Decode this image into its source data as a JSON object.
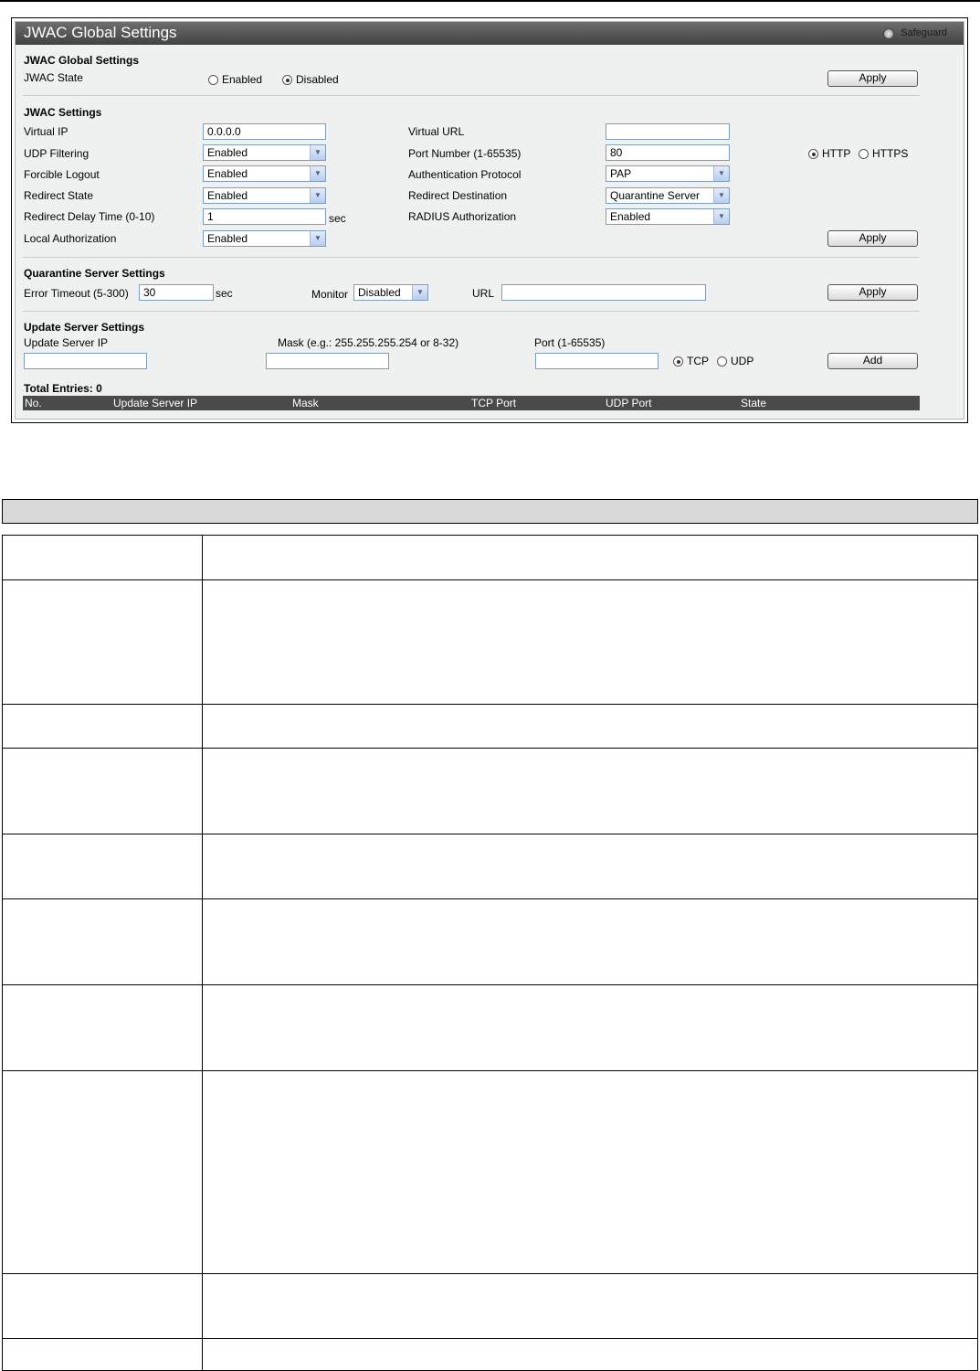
{
  "panel": {
    "title": "JWAC Global Settings",
    "safeguard_label": "Safeguard"
  },
  "global_settings": {
    "heading": "JWAC Global Settings",
    "state_label": "JWAC State",
    "enabled_label": "Enabled",
    "disabled_label": "Disabled",
    "state_value": "Disabled",
    "apply_label": "Apply"
  },
  "jwac_settings": {
    "heading": "JWAC Settings",
    "virtual_ip": {
      "label": "Virtual IP",
      "value": "0.0.0.0"
    },
    "virtual_url": {
      "label": "Virtual URL",
      "value": ""
    },
    "udp_filtering": {
      "label": "UDP Filtering",
      "value": "Enabled"
    },
    "port_number": {
      "label": "Port Number (1-65535)",
      "value": "80"
    },
    "protocol_http_label": "HTTP",
    "protocol_https_label": "HTTPS",
    "protocol_value": "HTTP",
    "forcible_logout": {
      "label": "Forcible Logout",
      "value": "Enabled"
    },
    "auth_protocol": {
      "label": "Authentication Protocol",
      "value": "PAP"
    },
    "redirect_state": {
      "label": "Redirect State",
      "value": "Enabled"
    },
    "redirect_destination": {
      "label": "Redirect Destination",
      "value": "Quarantine Server"
    },
    "redirect_delay": {
      "label": "Redirect Delay Time (0-10)",
      "value": "1",
      "unit": "sec"
    },
    "radius_authorization": {
      "label": "RADIUS Authorization",
      "value": "Enabled"
    },
    "local_authorization": {
      "label": "Local Authorization",
      "value": "Enabled"
    },
    "apply_label": "Apply"
  },
  "quarantine": {
    "heading": "Quarantine Server Settings",
    "error_timeout": {
      "label": "Error Timeout (5-300)",
      "value": "30",
      "unit": "sec"
    },
    "monitor": {
      "label": "Monitor",
      "value": "Disabled"
    },
    "url": {
      "label": "URL",
      "value": ""
    },
    "apply_label": "Apply"
  },
  "update_server": {
    "heading": "Update Server Settings",
    "ip_label": "Update Server IP",
    "mask_label": "Mask (e.g.: 255.255.255.254 or 8-32)",
    "port_label": "Port (1-65535)",
    "tcp_label": "TCP",
    "udp_label": "UDP",
    "transport_value": "TCP",
    "add_label": "Add",
    "total_entries": "Total Entries: 0",
    "columns": [
      "No.",
      "Update Server IP",
      "Mask",
      "TCP Port",
      "UDP Port",
      "State"
    ]
  }
}
